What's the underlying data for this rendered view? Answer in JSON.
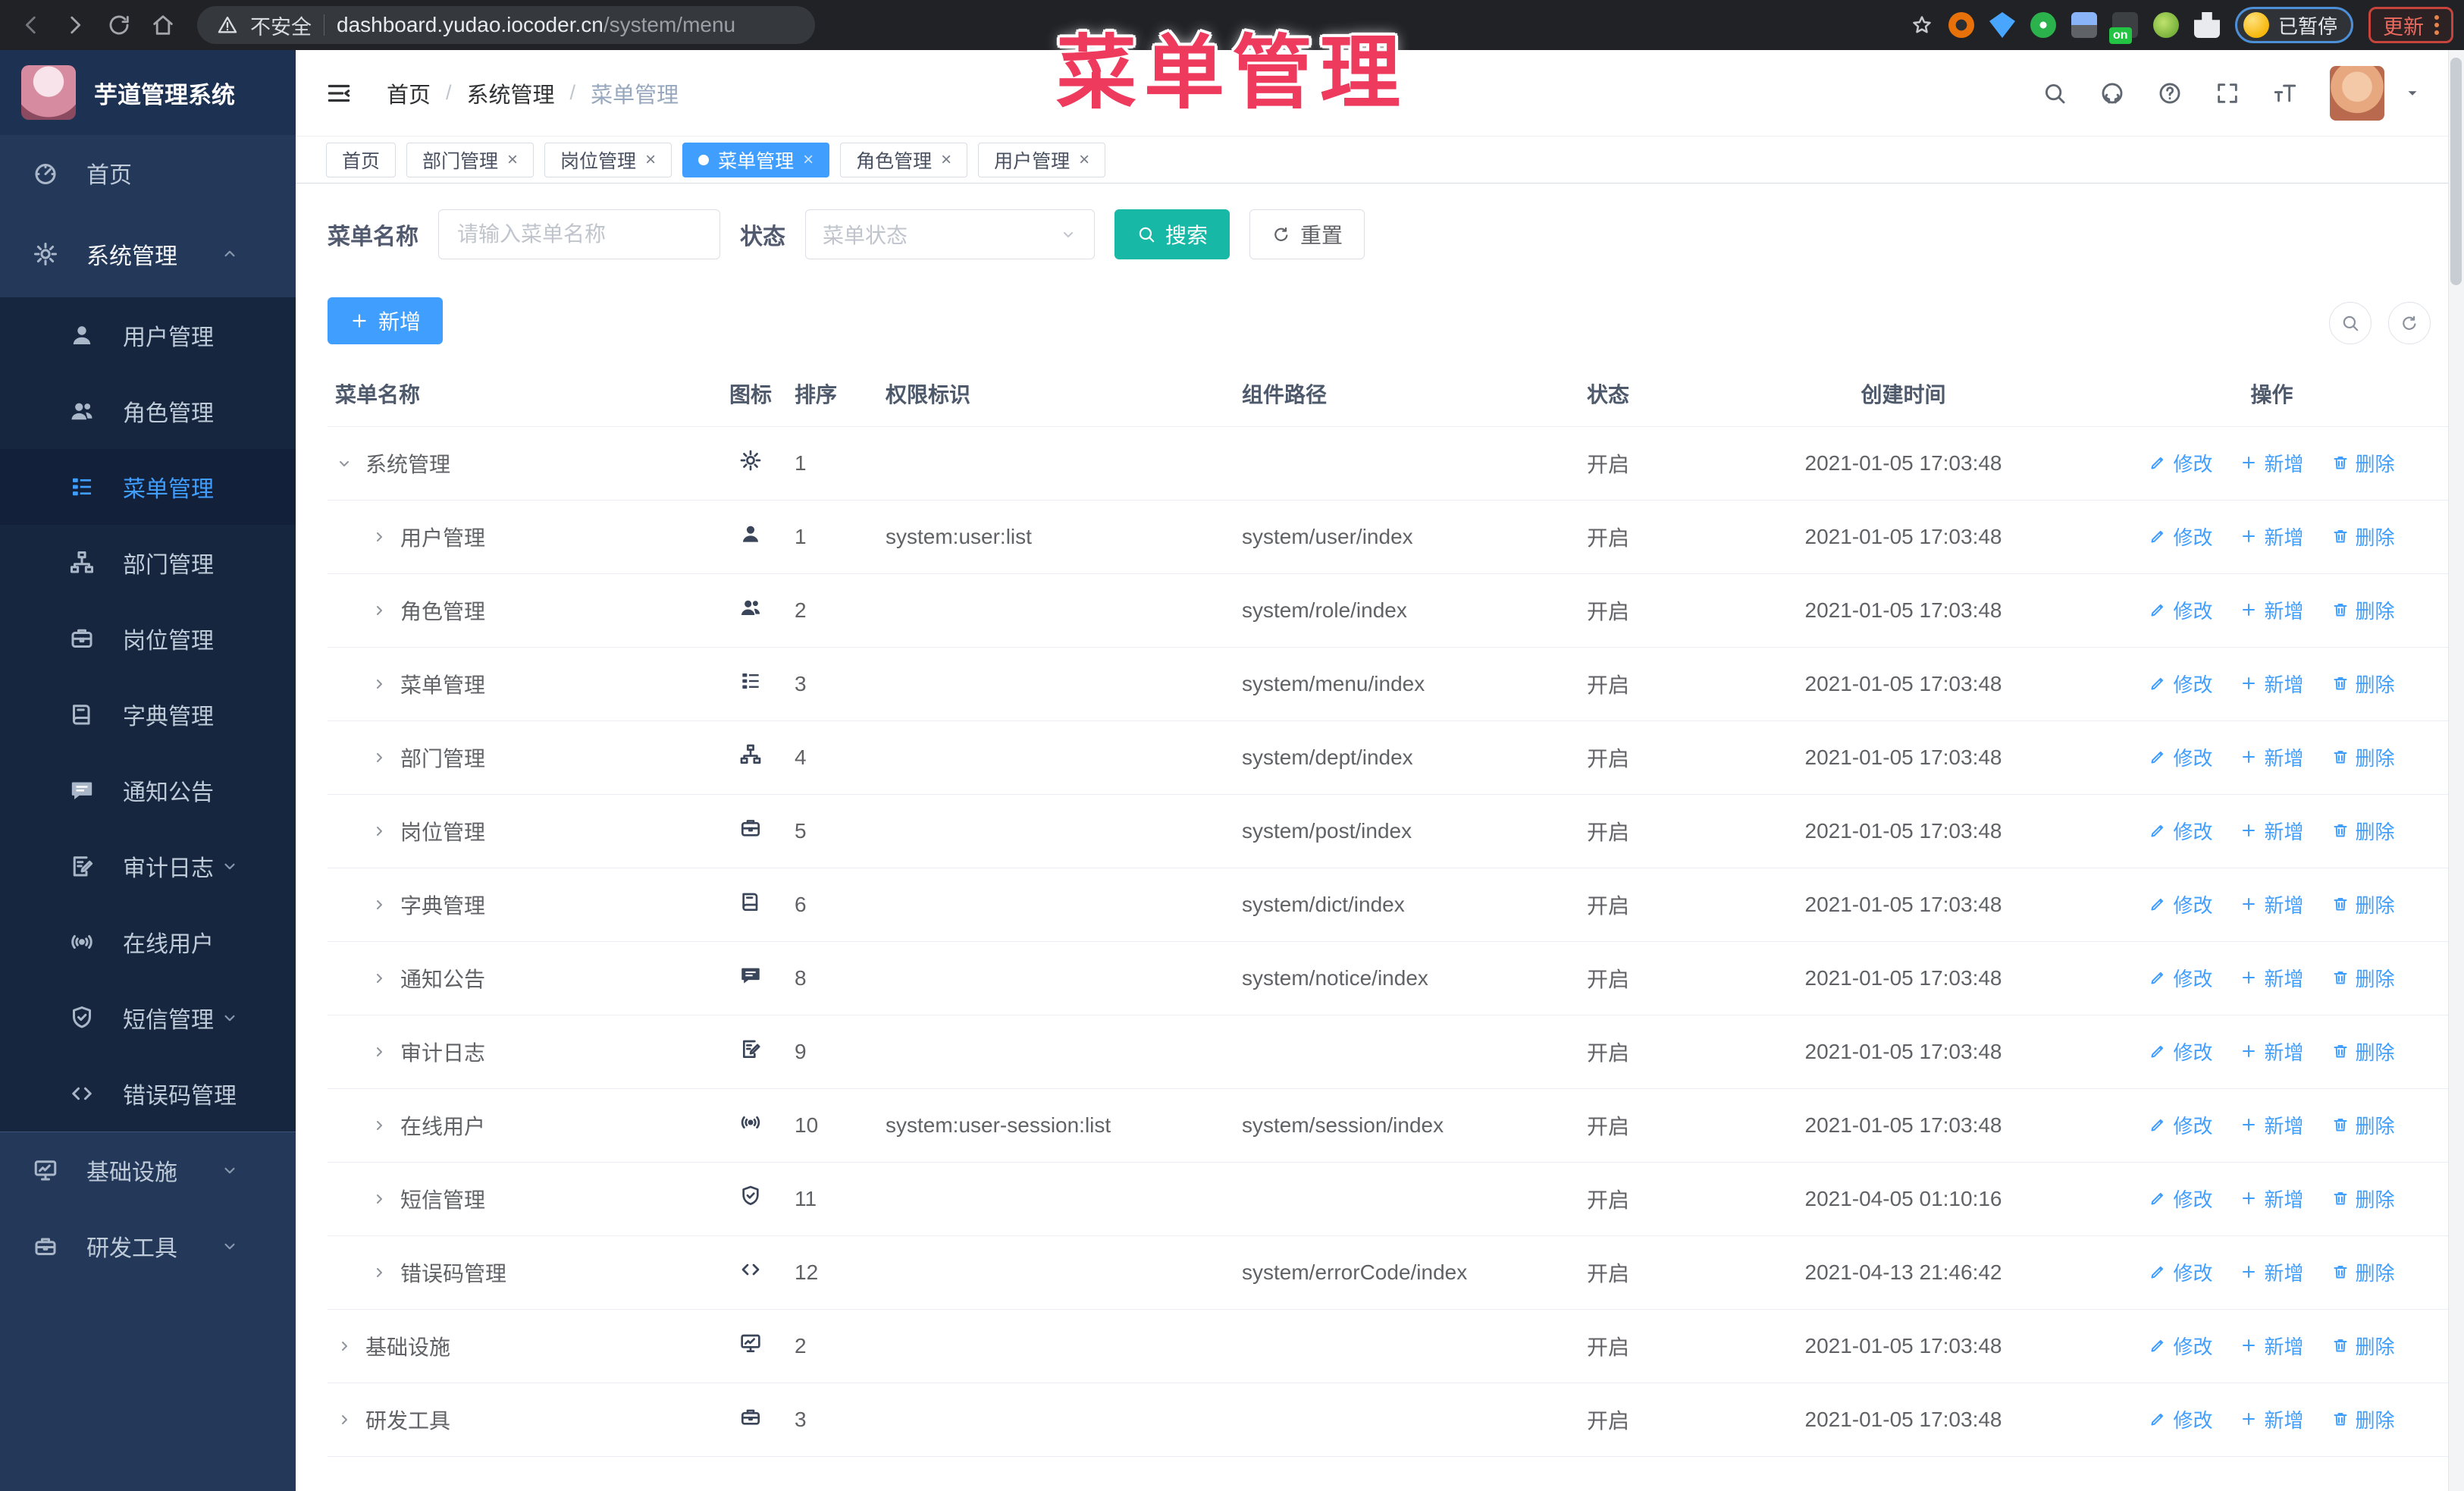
{
  "colors": {
    "accent": "#409eff",
    "search_teal": "#17b8a6",
    "overlay_red": "#ee3a5c",
    "sidebar_bg": "#24395a",
    "submenu_bg": "#16263f",
    "active_tab": "#409eff",
    "status_text": "#606266"
  },
  "browser": {
    "security_label": "不安全",
    "url_host": "dashboard.yudao.iocoder.cn",
    "url_path": "/system/menu",
    "extension_badge": "on",
    "profile_label": "已暂停",
    "update_label": "更新"
  },
  "overlay": {
    "title": "菜单管理"
  },
  "app": {
    "title": "芋道管理系统"
  },
  "breadcrumb": [
    "首页",
    "系统管理",
    "菜单管理"
  ],
  "sidebar": {
    "items": [
      {
        "label": "首页",
        "icon": "dashboard",
        "level": 0
      },
      {
        "label": "系统管理",
        "icon": "gear",
        "level": 0,
        "caret": "chev-up",
        "root_active": true
      },
      {
        "label": "用户管理",
        "icon": "user",
        "level": 1
      },
      {
        "label": "角色管理",
        "icon": "users",
        "level": 1
      },
      {
        "label": "菜单管理",
        "icon": "menu",
        "level": 1,
        "selected": true
      },
      {
        "label": "部门管理",
        "icon": "tree",
        "level": 1
      },
      {
        "label": "岗位管理",
        "icon": "post",
        "level": 1
      },
      {
        "label": "字典管理",
        "icon": "dict",
        "level": 1
      },
      {
        "label": "通知公告",
        "icon": "notice",
        "level": 1
      },
      {
        "label": "审计日志",
        "icon": "audit",
        "level": 1,
        "caret": "chev-down"
      },
      {
        "label": "在线用户",
        "icon": "online",
        "level": 1
      },
      {
        "label": "短信管理",
        "icon": "sms",
        "level": 1,
        "caret": "chev-down"
      },
      {
        "label": "错误码管理",
        "icon": "code",
        "level": 1,
        "divider_after": true
      },
      {
        "label": "基础设施",
        "icon": "infra",
        "level": 0,
        "caret": "chev-down"
      },
      {
        "label": "研发工具",
        "icon": "tool",
        "level": 0,
        "caret": "chev-down"
      }
    ]
  },
  "tabs": [
    {
      "label": "首页",
      "closable": false,
      "active": false
    },
    {
      "label": "部门管理",
      "closable": true,
      "active": false
    },
    {
      "label": "岗位管理",
      "closable": true,
      "active": false
    },
    {
      "label": "菜单管理",
      "closable": true,
      "active": true
    },
    {
      "label": "角色管理",
      "closable": true,
      "active": false
    },
    {
      "label": "用户管理",
      "closable": true,
      "active": false
    }
  ],
  "filters": {
    "name_label": "菜单名称",
    "name_placeholder": "请输入菜单名称",
    "name_value": "",
    "status_label": "状态",
    "status_placeholder": "菜单状态",
    "search_label": "搜索",
    "reset_label": "重置"
  },
  "toolbar": {
    "add_label": "新增"
  },
  "table": {
    "columns": [
      "菜单名称",
      "图标",
      "排序",
      "权限标识",
      "组件路径",
      "状态",
      "创建时间",
      "操作"
    ],
    "actions": [
      {
        "label": "修改",
        "icon": "edit"
      },
      {
        "label": "新增",
        "icon": "plus"
      },
      {
        "label": "删除",
        "icon": "trash"
      }
    ],
    "rows": [
      {
        "name": "系统管理",
        "icon": "gear",
        "sort": "1",
        "perm": "",
        "path": "",
        "status": "开启",
        "time": "2021-01-05 17:03:48",
        "level": 0,
        "caret": "chev-down"
      },
      {
        "name": "用户管理",
        "icon": "user",
        "sort": "1",
        "perm": "system:user:list",
        "path": "system/user/index",
        "status": "开启",
        "time": "2021-01-05 17:03:48",
        "level": 1,
        "caret": "chev-right"
      },
      {
        "name": "角色管理",
        "icon": "users",
        "sort": "2",
        "perm": "",
        "path": "system/role/index",
        "status": "开启",
        "time": "2021-01-05 17:03:48",
        "level": 1,
        "caret": "chev-right"
      },
      {
        "name": "菜单管理",
        "icon": "menu",
        "sort": "3",
        "perm": "",
        "path": "system/menu/index",
        "status": "开启",
        "time": "2021-01-05 17:03:48",
        "level": 1,
        "caret": "chev-right"
      },
      {
        "name": "部门管理",
        "icon": "tree",
        "sort": "4",
        "perm": "",
        "path": "system/dept/index",
        "status": "开启",
        "time": "2021-01-05 17:03:48",
        "level": 1,
        "caret": "chev-right"
      },
      {
        "name": "岗位管理",
        "icon": "post",
        "sort": "5",
        "perm": "",
        "path": "system/post/index",
        "status": "开启",
        "time": "2021-01-05 17:03:48",
        "level": 1,
        "caret": "chev-right"
      },
      {
        "name": "字典管理",
        "icon": "dict",
        "sort": "6",
        "perm": "",
        "path": "system/dict/index",
        "status": "开启",
        "time": "2021-01-05 17:03:48",
        "level": 1,
        "caret": "chev-right"
      },
      {
        "name": "通知公告",
        "icon": "notice",
        "sort": "8",
        "perm": "",
        "path": "system/notice/index",
        "status": "开启",
        "time": "2021-01-05 17:03:48",
        "level": 1,
        "caret": "chev-right"
      },
      {
        "name": "审计日志",
        "icon": "audit",
        "sort": "9",
        "perm": "",
        "path": "",
        "status": "开启",
        "time": "2021-01-05 17:03:48",
        "level": 1,
        "caret": "chev-right"
      },
      {
        "name": "在线用户",
        "icon": "online",
        "sort": "10",
        "perm": "system:user-session:list",
        "path": "system/session/index",
        "status": "开启",
        "time": "2021-01-05 17:03:48",
        "level": 1,
        "caret": "chev-right"
      },
      {
        "name": "短信管理",
        "icon": "sms",
        "sort": "11",
        "perm": "",
        "path": "",
        "status": "开启",
        "time": "2021-04-05 01:10:16",
        "level": 1,
        "caret": "chev-right"
      },
      {
        "name": "错误码管理",
        "icon": "code",
        "sort": "12",
        "perm": "",
        "path": "system/errorCode/index",
        "status": "开启",
        "time": "2021-04-13 21:46:42",
        "level": 1,
        "caret": "chev-right"
      },
      {
        "name": "基础设施",
        "icon": "infra",
        "sort": "2",
        "perm": "",
        "path": "",
        "status": "开启",
        "time": "2021-01-05 17:03:48",
        "level": 0,
        "caret": "chev-right"
      },
      {
        "name": "研发工具",
        "icon": "tool",
        "sort": "3",
        "perm": "",
        "path": "",
        "status": "开启",
        "time": "2021-01-05 17:03:48",
        "level": 0,
        "caret": "chev-right"
      }
    ]
  }
}
